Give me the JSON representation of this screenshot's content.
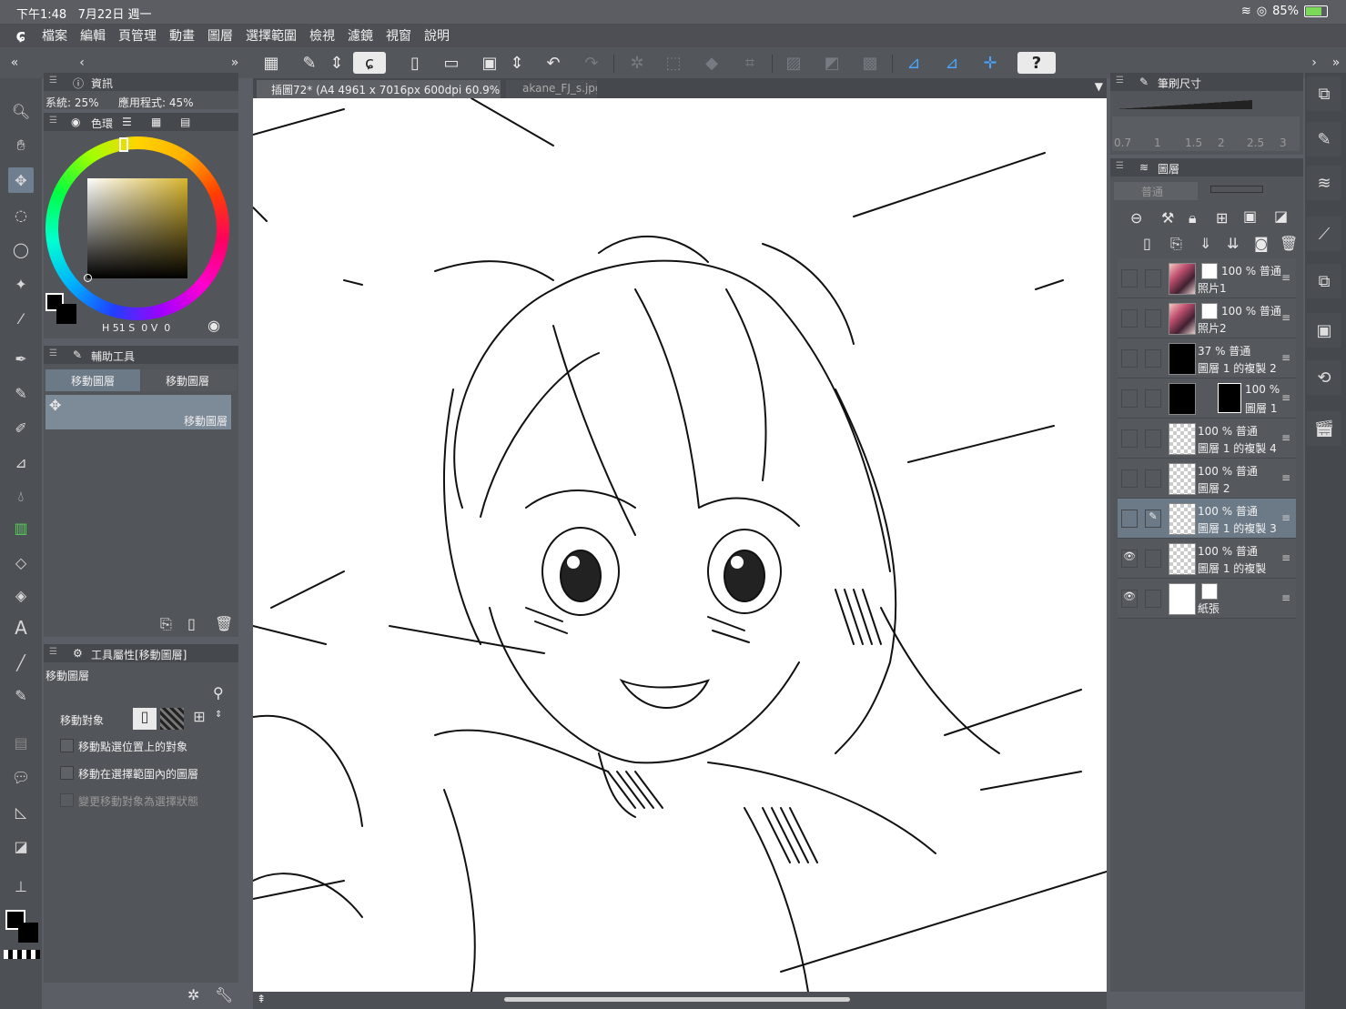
{
  "status": {
    "time": "下午1:48",
    "date": "7月22日 週一",
    "battery": "85%"
  },
  "menu": [
    "檔案",
    "編輯",
    "頁管理",
    "動畫",
    "圖層",
    "選擇範圍",
    "檢視",
    "濾鏡",
    "視窗",
    "說明"
  ],
  "tabs": {
    "active": "插圖72* (A4 4961 x 7016px 600dpi 60.9%)",
    "second": "akane_FJ_s.jpg"
  },
  "info_panel": {
    "title": "資訊",
    "system": "系統: 25%",
    "app": "應用程式: 45%"
  },
  "color_panel": {
    "title": "色環",
    "h_label": "H",
    "h_value": "51",
    "s_label": "S",
    "s_value": "0",
    "v_label": "V",
    "v_value": "0"
  },
  "sub_tool_panel": {
    "title": "輔助工具",
    "tab1": "移動圖層",
    "tab2": "移動圖層",
    "item": "移動圖層"
  },
  "tool_property": {
    "title": "工具屬性[移動圖層]",
    "tool_name": "移動圖層",
    "target_label": "移動對象",
    "opt1": "移動點選位置上的對象",
    "opt2": "移動在選擇範圍內的圖層",
    "opt3": "變更移動對象為選擇狀態"
  },
  "brush_size": {
    "title": "筆刷尺寸",
    "ticks": [
      "0.7",
      "1",
      "1.5",
      "2",
      "2.5",
      "3"
    ]
  },
  "layer_panel": {
    "title": "圖層",
    "blend": "普通",
    "layers": [
      {
        "top": "100 % 普通",
        "name": "照片1",
        "thumb": "photo"
      },
      {
        "top": "100 % 普通",
        "name": "照片2",
        "thumb": "photo"
      },
      {
        "top": "37 % 普通",
        "name": "圖層 1 的複製 2",
        "thumb": "black"
      },
      {
        "top": "100 %",
        "name": "圖層 1",
        "thumb": "black"
      },
      {
        "top": "100 % 普通",
        "name": "圖層 1 的複製 4",
        "thumb": "checker"
      },
      {
        "top": "100 % 普通",
        "name": "圖層 2",
        "thumb": "checker"
      },
      {
        "top": "100 % 普通",
        "name": "圖層 1 的複製 3",
        "thumb": "checker",
        "selected": true
      },
      {
        "top": "100 % 普通",
        "name": "圖層 1 的複製",
        "thumb": "checker",
        "visible": true
      },
      {
        "top": "",
        "name": "紙張",
        "thumb": "white",
        "visible": true
      }
    ]
  },
  "icons": {
    "help": "?"
  }
}
